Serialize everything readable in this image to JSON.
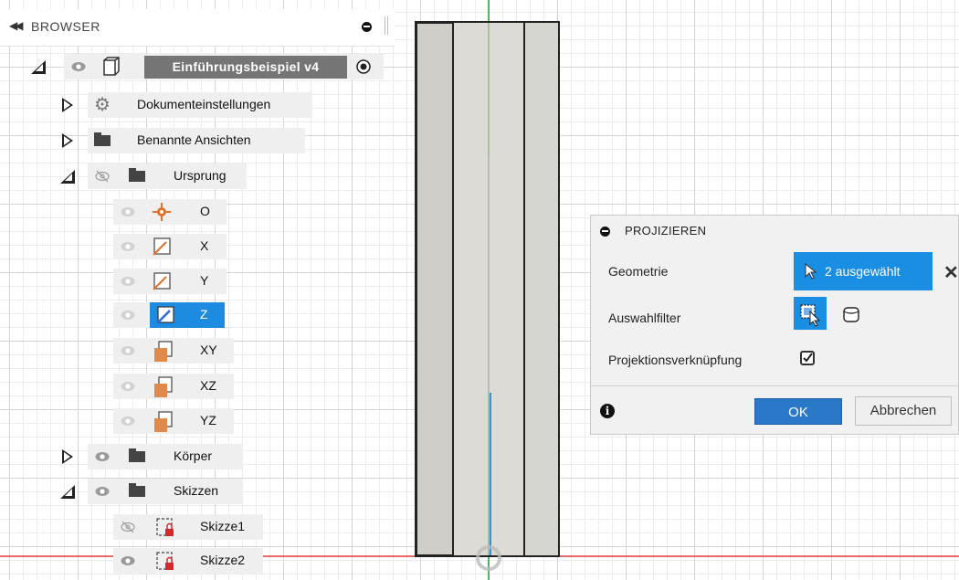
{
  "colors": {
    "accent": "#1c8be0",
    "root_bg": "#757575",
    "axis_x": "#e23a3a",
    "axis_y": "#22a13a",
    "axis_z": "#3a8fdc",
    "origin": "#e0702a",
    "sketch_lock": "#d8282b",
    "model_fill": "#cfcec9"
  },
  "browser": {
    "collapse_icon": "double-left-arrow",
    "title": "BROWSER",
    "pin_icon": "minus-circle-icon",
    "tree": {
      "root": {
        "label": "Einführungsbeispiel v4",
        "icon": "component-icon",
        "radio_icon": "radio-icon"
      },
      "doc_settings": {
        "label": "Dokumenteinstellungen",
        "icon": "gear-icon"
      },
      "named_views": {
        "label": "Benannte Ansichten",
        "icon": "folder-icon"
      },
      "origin": {
        "label": "Ursprung",
        "icon": "folder-icon",
        "items": [
          {
            "label": "O",
            "icon": "origin-point-icon"
          },
          {
            "label": "X",
            "icon": "axis-icon"
          },
          {
            "label": "Y",
            "icon": "axis-icon"
          },
          {
            "label": "Z",
            "icon": "axis-icon",
            "selected": true
          },
          {
            "label": "XY",
            "icon": "plane-icon"
          },
          {
            "label": "XZ",
            "icon": "plane-icon"
          },
          {
            "label": "YZ",
            "icon": "plane-icon"
          }
        ]
      },
      "bodies": {
        "label": "Körper",
        "icon": "folder-icon"
      },
      "sketches": {
        "label": "Skizzen",
        "icon": "folder-icon",
        "items": [
          {
            "label": "Skizze1",
            "icon": "sketch-icon",
            "hidden": true
          },
          {
            "label": "Skizze2",
            "icon": "sketch-icon"
          }
        ]
      }
    }
  },
  "dialog": {
    "title": "PROJIZIEREN",
    "collapse_icon": "minus-circle-icon",
    "geometry_label": "Geometrie",
    "geometry_button": "2 ausgewählt",
    "clear_icon": "close-icon",
    "filter_label": "Auswahlfilter",
    "filter_icons": [
      "select-faces-icon",
      "body-icon"
    ],
    "link_label": "Projektionsverknüpfung",
    "link_checked": true,
    "info_icon": "info-icon",
    "ok_label": "OK",
    "cancel_label": "Abbrechen"
  }
}
